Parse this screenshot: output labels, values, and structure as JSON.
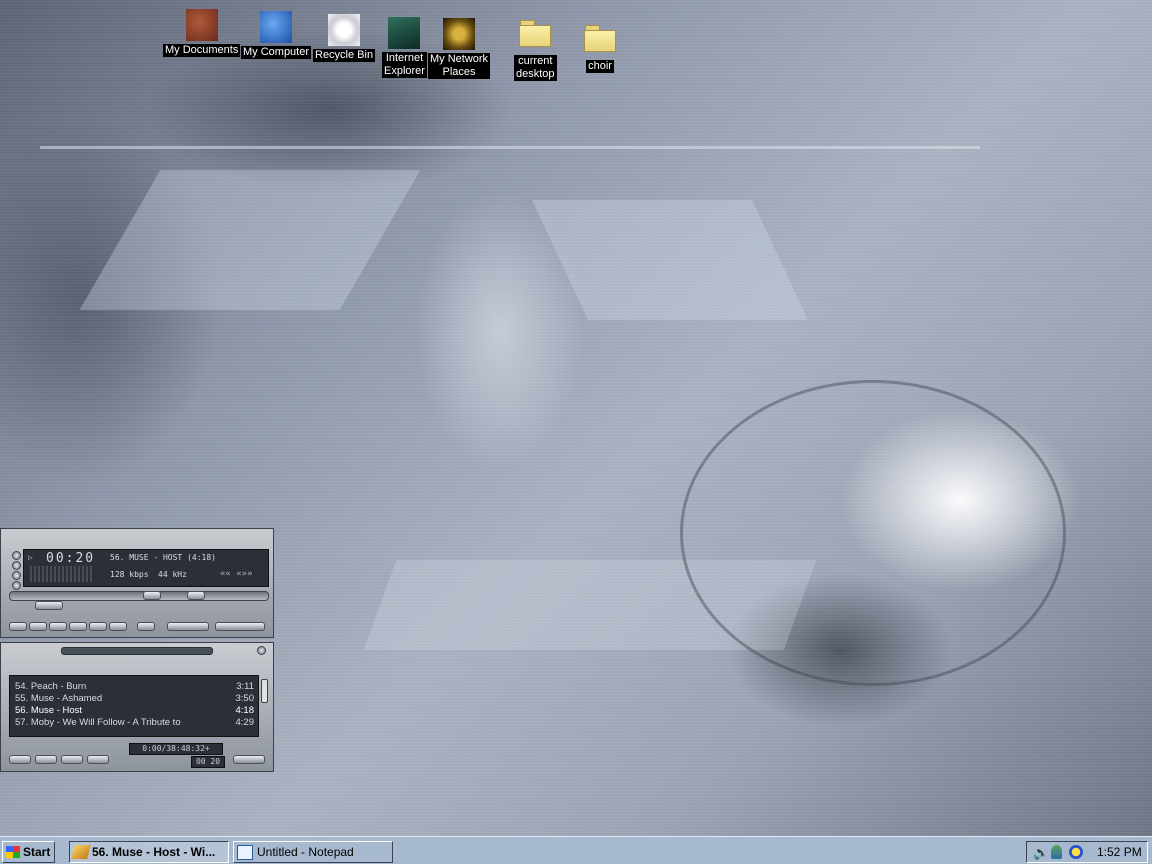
{
  "desktop": {
    "icons": [
      {
        "label": "My Documents",
        "icon": "my-documents-icon"
      },
      {
        "label": "My Computer",
        "icon": "my-computer-icon"
      },
      {
        "label": "Recycle Bin",
        "icon": "recycle-bin-icon"
      },
      {
        "label": "Internet\nExplorer",
        "icon": "internet-explorer-icon"
      },
      {
        "label": "My Network\nPlaces",
        "icon": "network-places-icon"
      },
      {
        "label": "current\ndesktop",
        "icon": "folder-icon"
      },
      {
        "label": "choir",
        "icon": "folder-icon"
      }
    ]
  },
  "winamp": {
    "player": {
      "time": "00:20",
      "title": "56. MUSE - HOST (4:18)",
      "bitrate": "128 kbps",
      "samplerate": "44 kHz"
    },
    "playlist": {
      "items": [
        {
          "title": "54. Peach - Burn",
          "duration": "3:11"
        },
        {
          "title": "55. Muse - Ashamed",
          "duration": "3:50"
        },
        {
          "title": "56. Muse - Host",
          "duration": "4:18"
        },
        {
          "title": "57. Moby - We Will Follow - A Tribute to",
          "duration": "4:29"
        }
      ],
      "current_index": 2,
      "total_time": "0:00/38:48:32+",
      "mini_time": "00 20"
    }
  },
  "taskbar": {
    "start_label": "Start",
    "tasks": [
      {
        "label": "56. Muse - Host - Wi...",
        "active": true,
        "icon": "winamp-icon"
      },
      {
        "label": "Untitled - Notepad",
        "active": false,
        "icon": "notepad-icon"
      }
    ],
    "tray_icons": [
      "volume-icon",
      "network-user-icon",
      "messenger-icon"
    ],
    "clock": "1:52 PM"
  }
}
